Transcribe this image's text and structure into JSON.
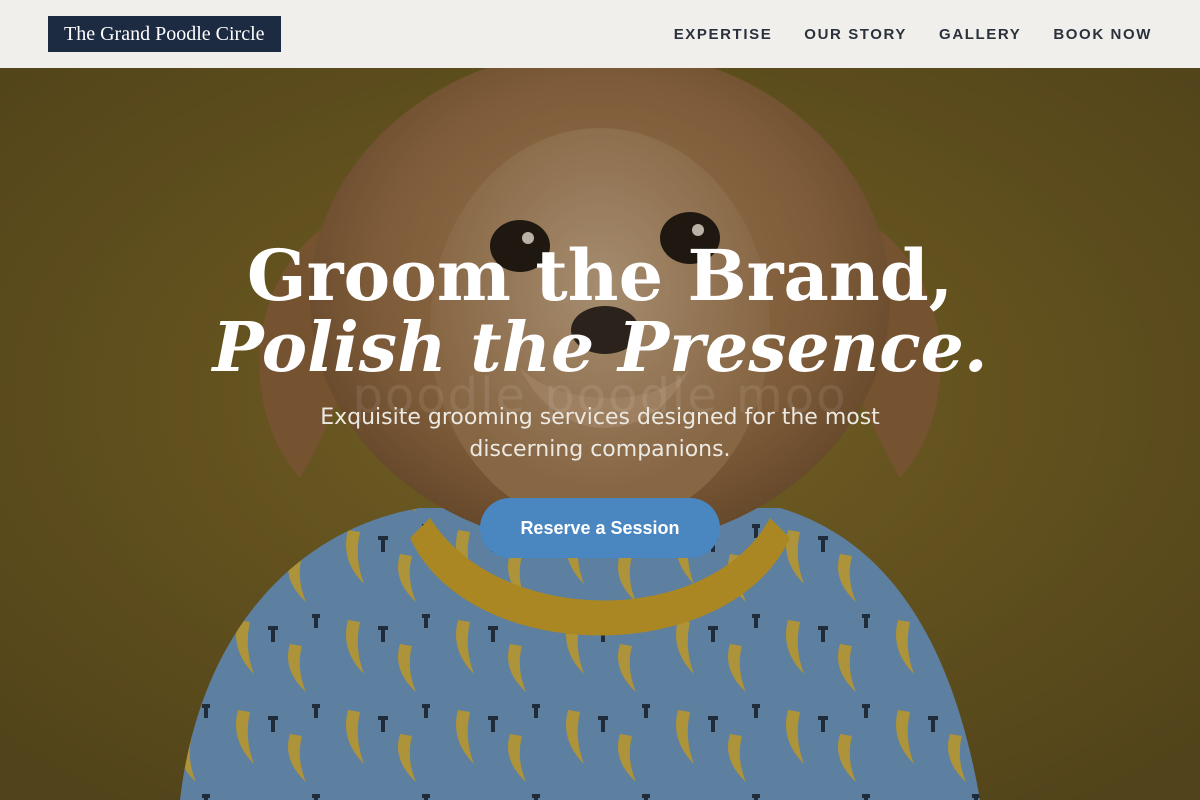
{
  "header": {
    "logo": "The Grand Poodle Circle",
    "nav": [
      "EXPERTISE",
      "OUR STORY",
      "GALLERY",
      "BOOK NOW"
    ]
  },
  "hero": {
    "watermark": "poodle poodle moo",
    "headline_line1": "Groom the Brand,",
    "headline_line2": "Polish the Presence.",
    "subtitle": "Exquisite grooming services designed for the most discerning companions.",
    "cta_label": "Reserve a Session"
  },
  "colors": {
    "nav_background": "#f0efec",
    "logo_background": "#1c2a42",
    "hero_background": "#7a6526",
    "cta_background": "#4a86bf"
  }
}
